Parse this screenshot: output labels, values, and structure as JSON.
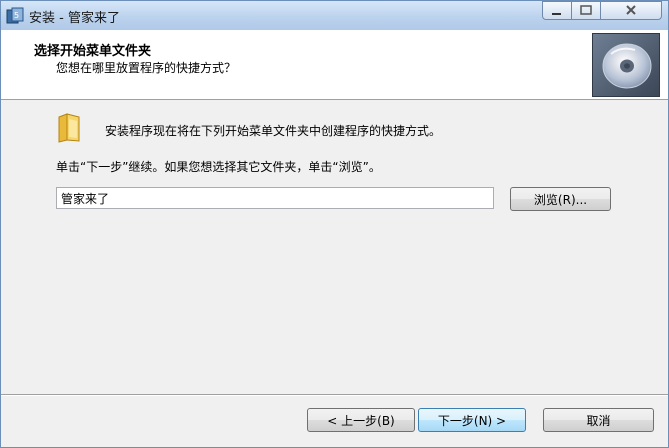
{
  "window": {
    "title": "安装 - 管家来了"
  },
  "header": {
    "title": "选择开始菜单文件夹",
    "subtitle": "您想在哪里放置程序的快捷方式？"
  },
  "content": {
    "info_text": "安装程序现在将在下列开始菜单文件夹中创建程序的快捷方式。",
    "instruction_text": "单击“下一步”继续。如果您想选择其它文件夹，单击“浏览”。",
    "folder_input_value": "管家来了",
    "browse_label": "浏览(R)..."
  },
  "footer": {
    "back_label": "< 上一步(B)",
    "next_label": "下一步(N) >",
    "cancel_label": "取消"
  },
  "icons": {
    "app": "installer-app-icon",
    "folder": "folder-icon",
    "banner": "cd-disc-icon"
  }
}
